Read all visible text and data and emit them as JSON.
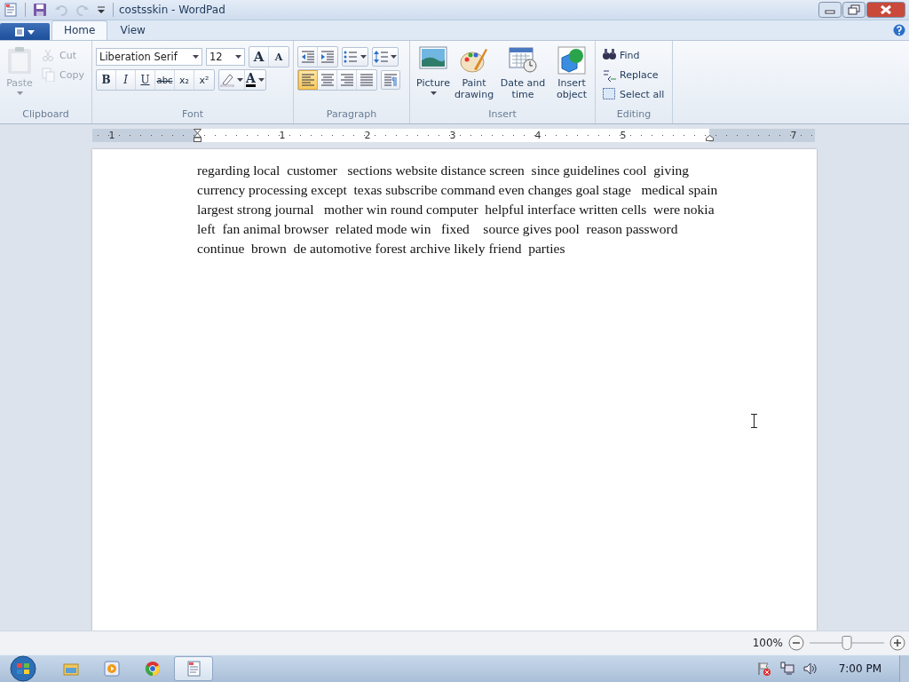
{
  "window": {
    "title": "costsskin - WordPad"
  },
  "tabs": [
    {
      "label": "Home",
      "selected": true
    },
    {
      "label": "View",
      "selected": false
    }
  ],
  "clipboard": {
    "label": "Clipboard",
    "paste": {
      "label": "Paste",
      "disabled": true
    },
    "items": [
      {
        "kind": "cut",
        "label": "Cut",
        "disabled": true
      },
      {
        "kind": "copy",
        "label": "Copy",
        "disabled": true
      }
    ]
  },
  "font": {
    "label": "Font",
    "family": "Liberation Serif",
    "size": "12",
    "sizers": [
      "A",
      "A"
    ],
    "styles": [
      {
        "kind": "bold",
        "label": "B"
      },
      {
        "kind": "italic",
        "label": "I"
      },
      {
        "kind": "underline",
        "label": "U"
      },
      {
        "kind": "strike",
        "label": "abc"
      },
      {
        "kind": "sub",
        "label": "x₂"
      },
      {
        "kind": "sup",
        "label": "x²"
      }
    ],
    "color_label": "A"
  },
  "paragraph": {
    "label": "Paragraph",
    "alignment": [
      {
        "selected": true
      },
      {
        "selected": false
      },
      {
        "selected": false
      },
      {
        "selected": false
      }
    ]
  },
  "insert": {
    "label": "Insert",
    "items": [
      {
        "kind": "picture",
        "label": "Picture"
      },
      {
        "kind": "paint",
        "label": "Paint drawing"
      },
      {
        "kind": "datetime",
        "label": "Date and time"
      },
      {
        "kind": "object",
        "label": "Insert object"
      }
    ]
  },
  "editing": {
    "label": "Editing",
    "items": [
      {
        "kind": "find",
        "label": "Find"
      },
      {
        "kind": "replace",
        "label": "Replace"
      },
      {
        "kind": "select",
        "label": "Select all"
      }
    ]
  },
  "ruler": {
    "labels": [
      "1",
      "1",
      "2",
      "3",
      "4",
      "5",
      "7"
    ]
  },
  "document": {
    "lines": [
      "regarding local  customer   sections website distance screen  since guidelines cool  giving",
      "currency processing except  texas subscribe command even changes goal stage   medical spain",
      "largest strong journal   mother win round computer  helpful interface written cells  were nokia",
      "left  fan animal browser  related mode win   fixed    source gives pool  reason password",
      "continue  brown  de automotive forest archive likely friend  parties"
    ]
  },
  "status_bar": {
    "zoom": "100%",
    "zoom_level": {
      "level": 0.5
    }
  },
  "taskbar": {
    "items": [
      {
        "kind": "explorer",
        "selected": false
      },
      {
        "kind": "media",
        "selected": false
      },
      {
        "kind": "browser",
        "selected": false
      },
      {
        "kind": "wordpad",
        "selected": true
      }
    ],
    "clock": "7:00 PM"
  }
}
